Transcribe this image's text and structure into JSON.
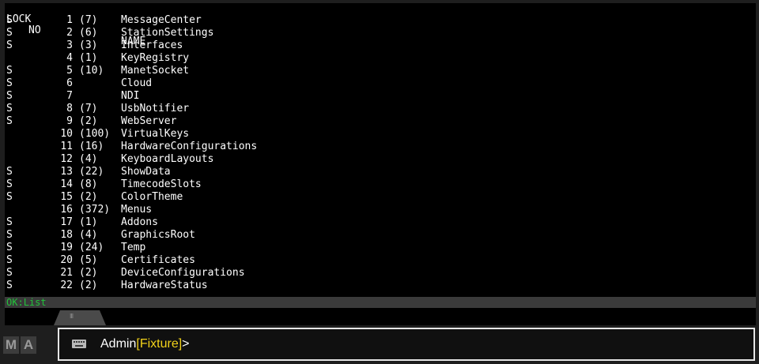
{
  "terminal": {
    "headers": {
      "lock": "LOCK",
      "no": "NO",
      "name": "NAME"
    },
    "rows": [
      {
        "lock": "S",
        "no": "1",
        "count": "(7)",
        "name": "MessageCenter"
      },
      {
        "lock": "S",
        "no": "2",
        "count": "(6)",
        "name": "StationSettings"
      },
      {
        "lock": "S",
        "no": "3",
        "count": "(3)",
        "name": "Interfaces"
      },
      {
        "lock": "",
        "no": "4",
        "count": "(1)",
        "name": "KeyRegistry"
      },
      {
        "lock": "S",
        "no": "5",
        "count": "(10)",
        "name": "ManetSocket"
      },
      {
        "lock": "S",
        "no": "6",
        "count": "",
        "name": "Cloud"
      },
      {
        "lock": "S",
        "no": "7",
        "count": "",
        "name": "NDI"
      },
      {
        "lock": "S",
        "no": "8",
        "count": "(7)",
        "name": "UsbNotifier"
      },
      {
        "lock": "S",
        "no": "9",
        "count": "(2)",
        "name": "WebServer"
      },
      {
        "lock": "",
        "no": "10",
        "count": "(100)",
        "name": "VirtualKeys"
      },
      {
        "lock": "",
        "no": "11",
        "count": "(16)",
        "name": "HardwareConfigurations"
      },
      {
        "lock": "",
        "no": "12",
        "count": "(4)",
        "name": "KeyboardLayouts"
      },
      {
        "lock": "S",
        "no": "13",
        "count": "(22)",
        "name": "ShowData"
      },
      {
        "lock": "S",
        "no": "14",
        "count": "(8)",
        "name": "TimecodeSlots"
      },
      {
        "lock": "S",
        "no": "15",
        "count": "(2)",
        "name": "ColorTheme"
      },
      {
        "lock": "",
        "no": "16",
        "count": "(372)",
        "name": "Menus"
      },
      {
        "lock": "S",
        "no": "17",
        "count": "(1)",
        "name": "Addons"
      },
      {
        "lock": "S",
        "no": "18",
        "count": "(4)",
        "name": "GraphicsRoot"
      },
      {
        "lock": "S",
        "no": "19",
        "count": "(24)",
        "name": "Temp"
      },
      {
        "lock": "S",
        "no": "20",
        "count": "(5)",
        "name": "Certificates"
      },
      {
        "lock": "S",
        "no": "21",
        "count": "(2)",
        "name": "DeviceConfigurations"
      },
      {
        "lock": "S",
        "no": "22",
        "count": "(2)",
        "name": "HardwareStatus"
      }
    ]
  },
  "status": {
    "ok": "OK:",
    "text": "List"
  },
  "tab": {
    "grip": "III"
  },
  "logo": {
    "m": "M",
    "a": "A"
  },
  "command": {
    "icon": "keyboard-icon",
    "user": "Admin",
    "open_bracket": "[",
    "context": "Fixture",
    "close_bracket": "]",
    "caret": ">"
  },
  "colors": {
    "terminal_bg": "#000000",
    "terminal_text": "#ffffff",
    "status_ok": "#22c33a",
    "prompt_context": "#f2d21a",
    "command_border": "#e6e6e6"
  }
}
